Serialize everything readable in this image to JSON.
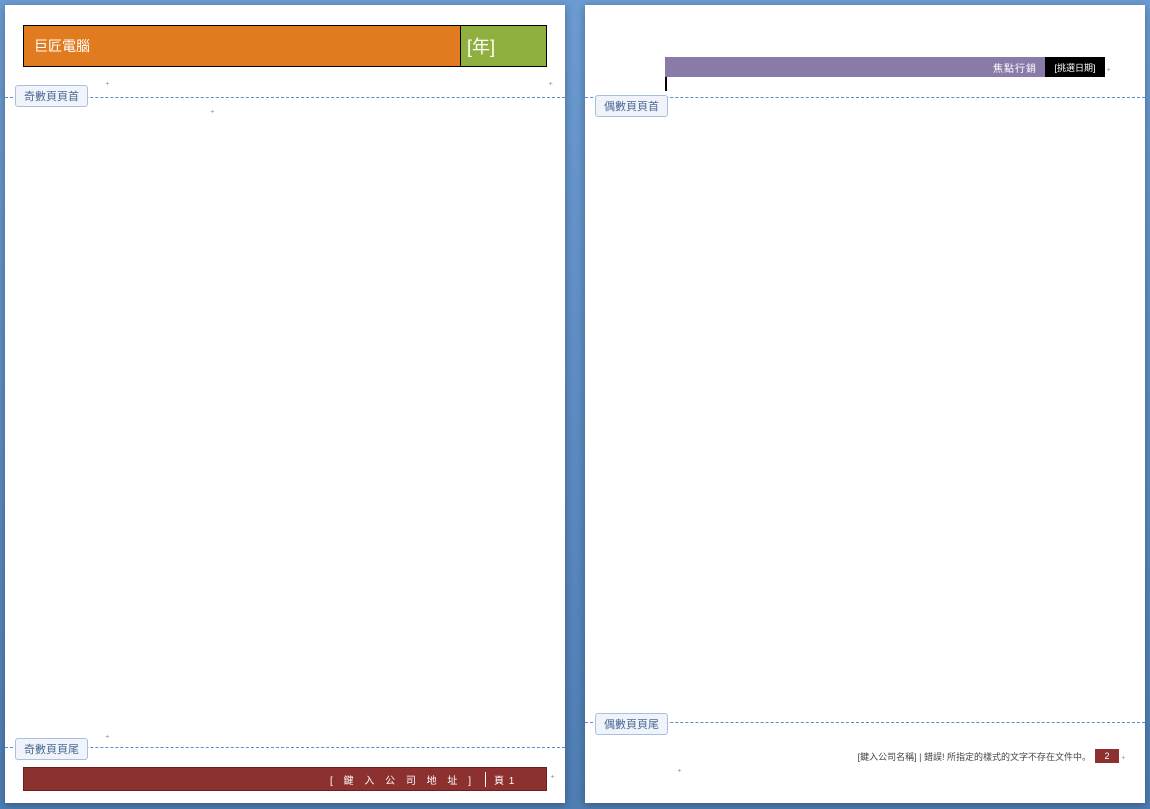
{
  "odd_page": {
    "header_tag": "奇數頁頁首",
    "footer_tag": "奇數頁頁尾",
    "banner_title": "巨匠電腦",
    "banner_year": "[年]",
    "footer_address": "[ 鍵 入 公 司 地 址 ]",
    "footer_page": "頁 1"
  },
  "even_page": {
    "header_tag": "偶數頁頁首",
    "footer_tag": "偶數頁頁尾",
    "banner_label": "焦點行銷",
    "banner_date": "[挑選日期]",
    "footer_text": "[鍵入公司名稱] | 錯誤! 所指定的樣式的文字不存在文件中。",
    "footer_page": "2"
  }
}
